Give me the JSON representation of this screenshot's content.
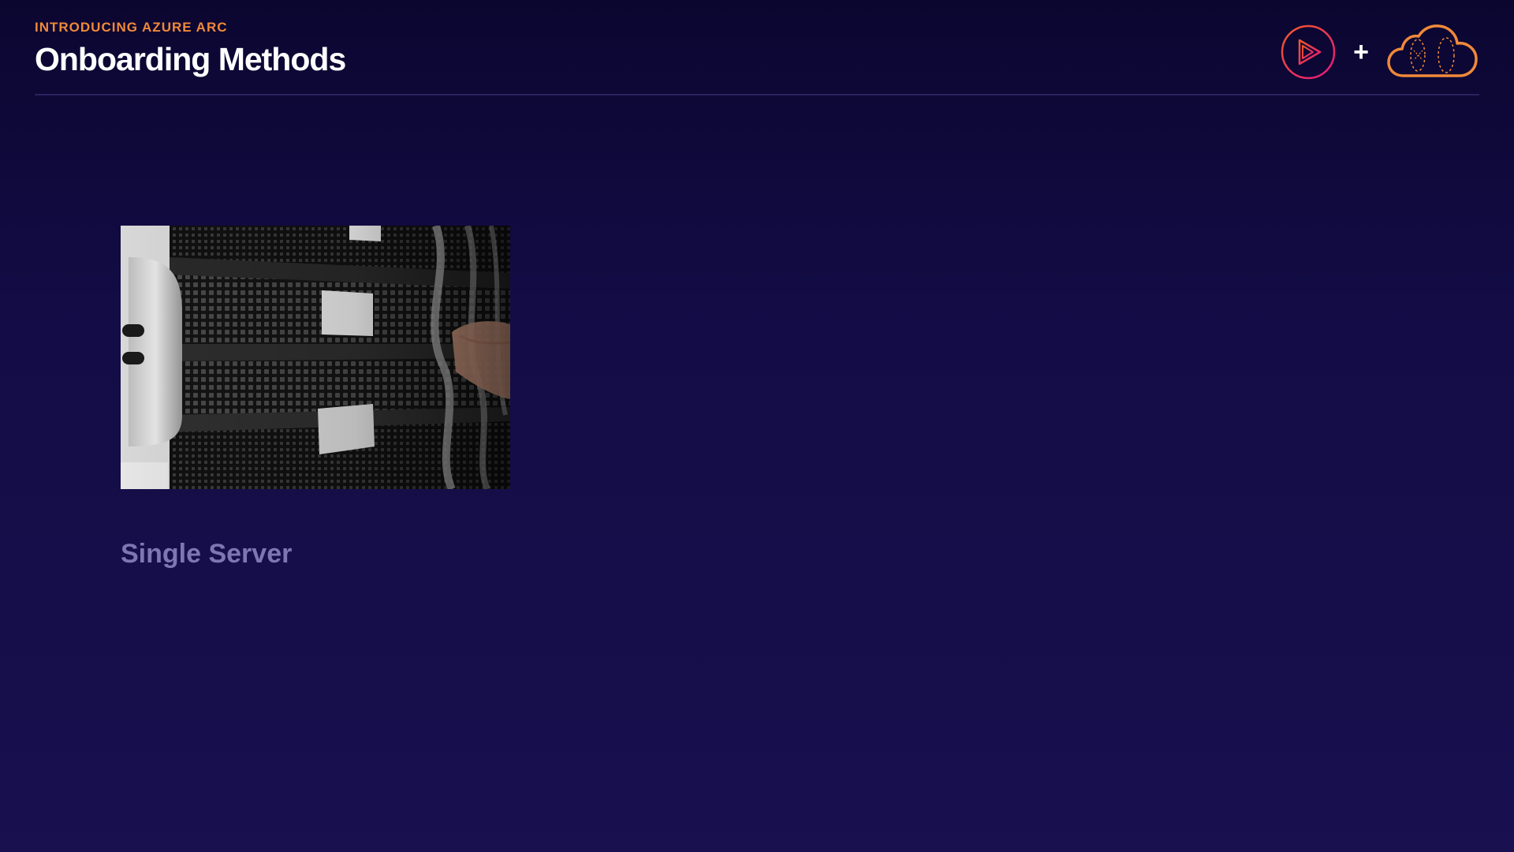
{
  "header": {
    "eyebrow": "INTRODUCING AZURE ARC",
    "title": "Onboarding Methods"
  },
  "logos": {
    "play_logo_icon": "pluralsight-play-icon",
    "plus": "+",
    "cloud_logo_icon": "cloud-icon"
  },
  "card": {
    "image_icon": "server-rack-photo",
    "caption": "Single Server"
  },
  "colors": {
    "accent": "#f0893a",
    "play_gradient_start": "#f05a28",
    "play_gradient_end": "#e8157f",
    "cloud": "#f0893a",
    "caption": "#7e76b4"
  }
}
